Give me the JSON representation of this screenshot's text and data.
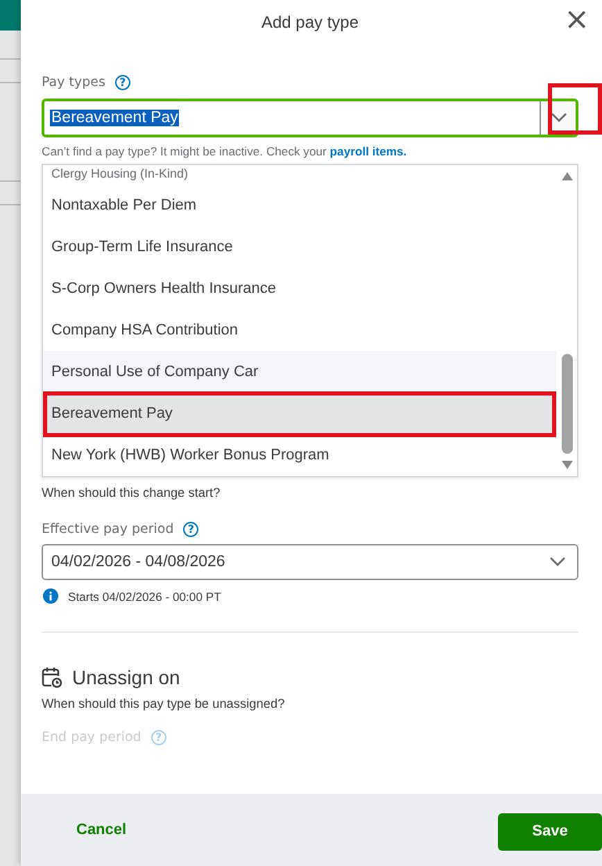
{
  "dialog": {
    "title": "Add pay type",
    "close": "×"
  },
  "pay_types": {
    "label": "Pay types",
    "help": "?",
    "value": "Bereavement Pay",
    "text_selected": true,
    "toggle_highlighted": true,
    "hint": "Can’t find a pay type? It might be inactive. Check your ",
    "hint_link": "payroll items."
  },
  "options": [
    {
      "label": "Clergy Housing (In-Kind)",
      "hovered": false,
      "selected": false,
      "highlighted": false
    },
    {
      "label": "Nontaxable Per Diem",
      "hovered": false,
      "selected": false,
      "highlighted": false
    },
    {
      "label": "Group-Term Life Insurance",
      "hovered": false,
      "selected": false,
      "highlighted": false
    },
    {
      "label": "S-Corp Owners Health Insurance",
      "hovered": false,
      "selected": false,
      "highlighted": false
    },
    {
      "label": "Company HSA Contribution",
      "hovered": false,
      "selected": false,
      "highlighted": false
    },
    {
      "label": "Personal Use of Company Car",
      "hovered": true,
      "selected": false,
      "highlighted": false
    },
    {
      "label": "Bereavement Pay",
      "hovered": false,
      "selected": true,
      "highlighted": true
    },
    {
      "label": "New York (HWB) Worker Bonus Program",
      "hovered": false,
      "selected": false,
      "highlighted": false
    }
  ],
  "start": {
    "question": "When should this change start?",
    "label": "Effective pay period",
    "help": "?",
    "value": "04/02/2026 - 04/08/2026",
    "info": "Starts 04/02/2026 - 00:00 PT"
  },
  "unassign": {
    "heading": "Unassign on",
    "question": "When should this pay type be unassigned?",
    "label": "End pay period",
    "help": "?",
    "disabled": true
  },
  "footer": {
    "cancel": "Cancel",
    "save": "Save"
  }
}
